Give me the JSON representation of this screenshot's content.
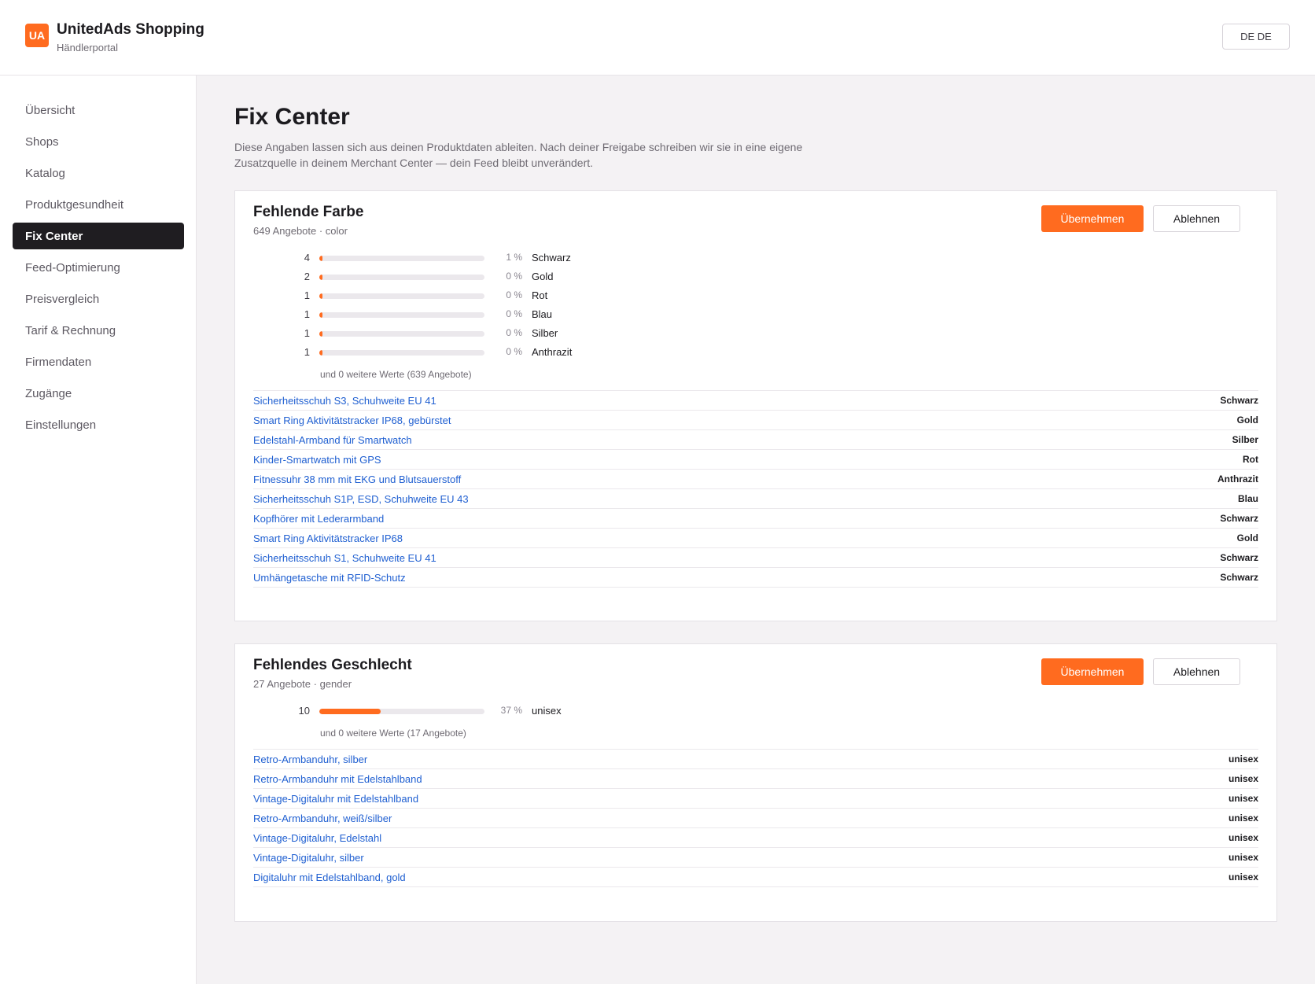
{
  "header": {
    "logo_text": "UA",
    "title": "UnitedAds Shopping",
    "subtitle": "Händlerportal",
    "language": "DE DE"
  },
  "sidebar": {
    "items": [
      {
        "label": "Übersicht",
        "active": false
      },
      {
        "label": "Shops",
        "active": false
      },
      {
        "label": "Katalog",
        "active": false
      },
      {
        "label": "Produktgesundheit",
        "active": false
      },
      {
        "label": "Fix Center",
        "active": true
      },
      {
        "label": "Feed-Optimierung",
        "active": false
      },
      {
        "label": "Preisvergleich",
        "active": false
      },
      {
        "label": "Tarif & Rechnung",
        "active": false
      },
      {
        "label": "Firmendaten",
        "active": false
      },
      {
        "label": "Zugänge",
        "active": false
      },
      {
        "label": "Einstellungen",
        "active": false
      }
    ]
  },
  "main": {
    "title": "Fix Center",
    "description": "Diese Angaben lassen sich aus deinen Produktdaten ableiten. Nach deiner Freigabe schreiben wir sie in eine eigene Zusatzquelle in deinem Merchant Center — dein Feed bleibt unverändert."
  },
  "cards": [
    {
      "title": "Fehlende Farbe",
      "subtitle": "649 Angebote · color",
      "accept_label": "Übernehmen",
      "decline_label": "Ablehnen",
      "distribution": [
        {
          "count": "4",
          "percent_text": "1 %",
          "fraction": 0.01,
          "label": "Schwarz"
        },
        {
          "count": "2",
          "percent_text": "0 %",
          "fraction": 0.0,
          "label": "Gold"
        },
        {
          "count": "1",
          "percent_text": "0 %",
          "fraction": 0.0,
          "label": "Rot"
        },
        {
          "count": "1",
          "percent_text": "0 %",
          "fraction": 0.0,
          "label": "Blau"
        },
        {
          "count": "1",
          "percent_text": "0 %",
          "fraction": 0.0,
          "label": "Silber"
        },
        {
          "count": "1",
          "percent_text": "0 %",
          "fraction": 0.0,
          "label": "Anthrazit"
        }
      ],
      "more_text": "und 0 weitere Werte (639 Angebote)",
      "offers": [
        {
          "name": "Sicherheitsschuh S3, Schuhweite EU 41",
          "value": "Schwarz"
        },
        {
          "name": "Smart Ring Aktivitätstracker IP68, gebürstet",
          "value": "Gold"
        },
        {
          "name": "Edelstahl-Armband für Smartwatch",
          "value": "Silber"
        },
        {
          "name": "Kinder-Smartwatch mit GPS",
          "value": "Rot"
        },
        {
          "name": "Fitnessuhr 38 mm mit EKG und Blutsauerstoff",
          "value": "Anthrazit"
        },
        {
          "name": "Sicherheitsschuh S1P, ESD, Schuhweite EU 43",
          "value": "Blau"
        },
        {
          "name": "Kopfhörer mit Lederarmband",
          "value": "Schwarz"
        },
        {
          "name": "Smart Ring Aktivitätstracker IP68",
          "value": "Gold"
        },
        {
          "name": "Sicherheitsschuh S1, Schuhweite EU 41",
          "value": "Schwarz"
        },
        {
          "name": "Umhängetasche mit RFID-Schutz",
          "value": "Schwarz"
        }
      ]
    },
    {
      "title": "Fehlendes Geschlecht",
      "subtitle": "27 Angebote · gender",
      "accept_label": "Übernehmen",
      "decline_label": "Ablehnen",
      "distribution": [
        {
          "count": "10",
          "percent_text": "37 %",
          "fraction": 0.37,
          "label": "unisex"
        }
      ],
      "more_text": "und 0 weitere Werte (17 Angebote)",
      "offers": [
        {
          "name": "Retro-Armbanduhr, silber",
          "value": "unisex"
        },
        {
          "name": "Retro-Armbanduhr mit Edelstahlband",
          "value": "unisex"
        },
        {
          "name": "Vintage-Digitaluhr mit Edelstahlband",
          "value": "unisex"
        },
        {
          "name": "Retro-Armbanduhr, weiß/silber",
          "value": "unisex"
        },
        {
          "name": "Vintage-Digitaluhr, Edelstahl",
          "value": "unisex"
        },
        {
          "name": "Vintage-Digitaluhr, silber",
          "value": "unisex"
        },
        {
          "name": "Digitaluhr mit Edelstahlband, gold",
          "value": "unisex"
        }
      ]
    }
  ],
  "colors": {
    "accent": "#ff6b1f",
    "link": "#1f5fd1",
    "active_nav": "#1f1d21"
  }
}
